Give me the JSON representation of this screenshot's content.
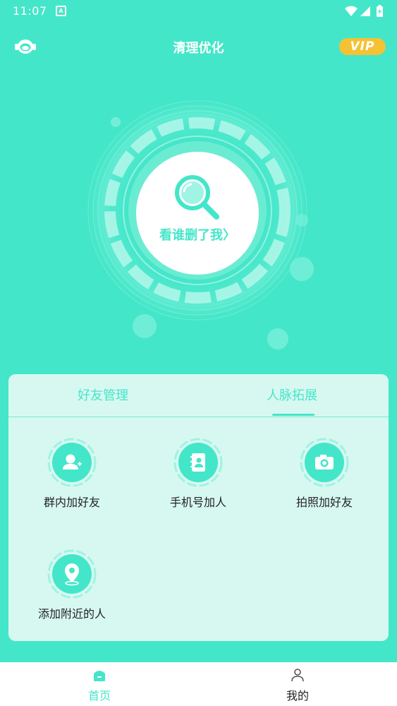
{
  "status_bar": {
    "time": "11:07",
    "notif_letter": "A"
  },
  "header": {
    "title": "清理优化",
    "vip_label": "VIP",
    "service_icon": "headset-icon"
  },
  "scan": {
    "label": "看谁删了我",
    "arrow": "〉",
    "icon": "search-icon"
  },
  "tabs": [
    {
      "label": "好友管理",
      "active": false
    },
    {
      "label": "人脉拓展",
      "active": true
    }
  ],
  "features": [
    {
      "label": "群内加好友",
      "icon": "add-user-icon"
    },
    {
      "label": "手机号加人",
      "icon": "contacts-book-icon"
    },
    {
      "label": "拍照加好友",
      "icon": "camera-icon"
    },
    {
      "label": "添加附近的人",
      "icon": "location-pin-icon"
    }
  ],
  "bottom_nav": [
    {
      "label": "首页",
      "icon": "home-icon",
      "active": true
    },
    {
      "label": "我的",
      "icon": "person-icon",
      "active": false
    }
  ],
  "colors": {
    "accent": "#44e6c9",
    "panel": "#d7f8f1",
    "vip": "#f5c233"
  }
}
